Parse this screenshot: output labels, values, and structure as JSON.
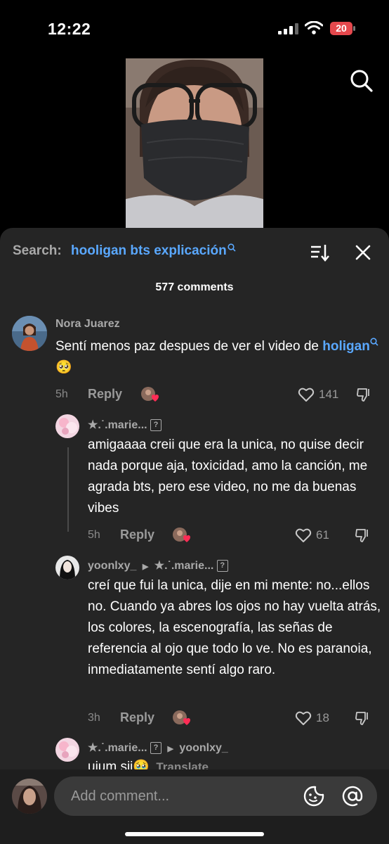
{
  "status_bar": {
    "time": "12:22",
    "battery": "20"
  },
  "sheet": {
    "search_label": "Search:",
    "search_term": "hooligan bts explicación",
    "comment_count": "577 comments"
  },
  "comments": [
    {
      "username": "Nora Juarez",
      "text": "Sentí menos paz despues de ver el video de",
      "link": "holigan",
      "emoji": "🥺",
      "time": "5h",
      "reply_label": "Reply",
      "likes": "141"
    },
    {
      "username": "★.˙.marie...",
      "text": "amigaaaa creii que era la unica, no quise decir nada porque aja, toxicidad, amo la canción, me agrada bts, pero ese video, no me da buenas vibes",
      "time": "5h",
      "reply_label": "Reply",
      "likes": "61"
    },
    {
      "username": "yoonlxy_",
      "reply_to": "★.˙.marie...",
      "text": "creí que fui la unica, dije en mi mente: no...ellos no. Cuando ya abres los ojos no hay vuelta atrás, los colores, la escenografía, las señas de referencia al ojo que todo lo ve. No es paranoia, inmediatamente sentí algo raro.",
      "time": "3h",
      "reply_label": "Reply",
      "likes": "18"
    },
    {
      "username": "★.˙.marie...",
      "reply_to": "yoonlxy_",
      "text": "uium sii🥹",
      "translate": "Translate"
    }
  ],
  "input": {
    "placeholder": "Add comment..."
  },
  "colors": {
    "accent": "#5aa8ff",
    "sheet": "#252525",
    "battery_badge": "#e5484d"
  }
}
